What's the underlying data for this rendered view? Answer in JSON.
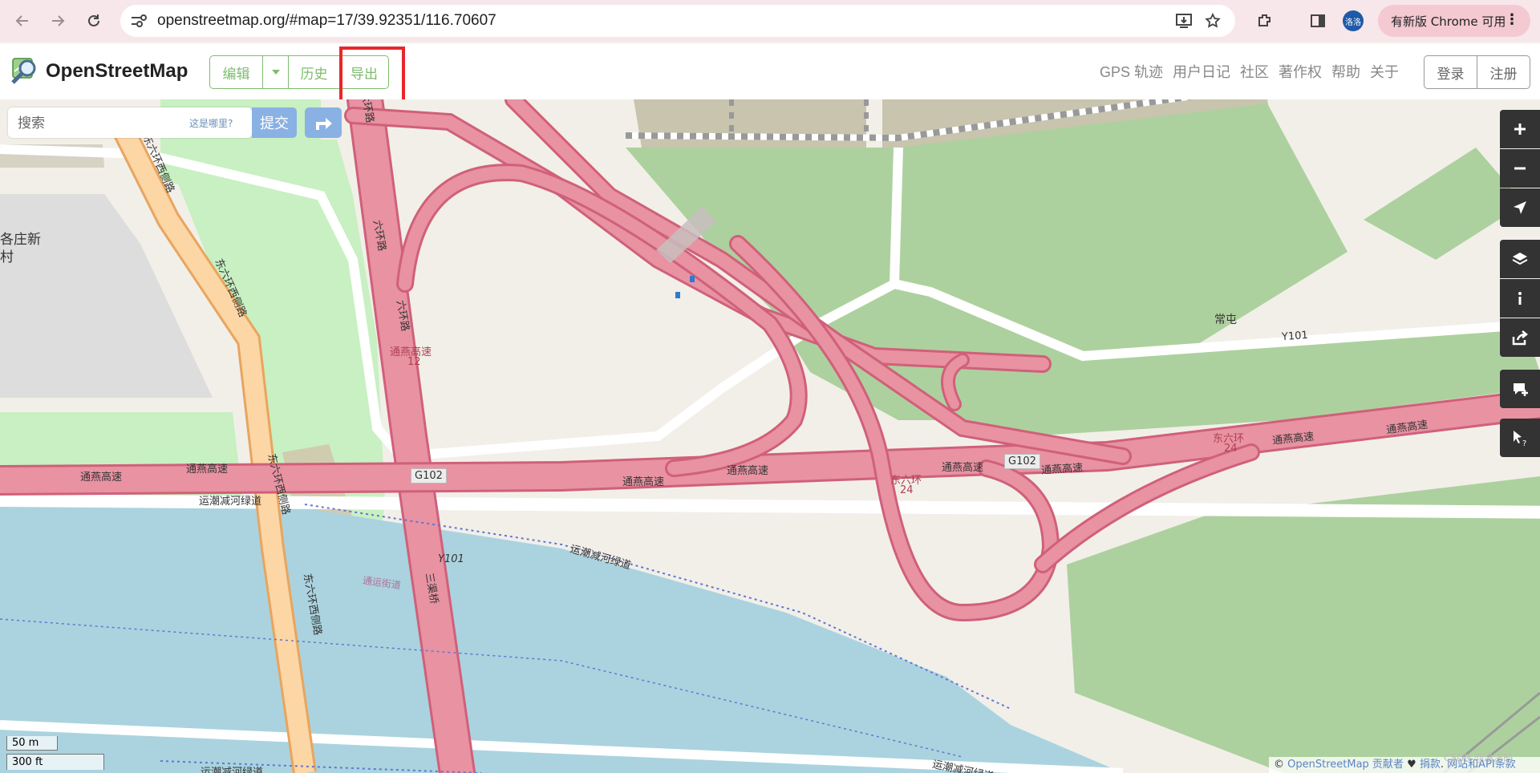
{
  "browser": {
    "url": "openstreetmap.org/#map=17/39.92351/116.70607",
    "profile_initials": "洛洛",
    "update_label": "有新版 Chrome 可用",
    "menu_glyph": "⋮"
  },
  "header": {
    "site_title": "OpenStreetMap",
    "edit_label": "编辑",
    "history_label": "历史",
    "export_label": "导出",
    "nav_links": [
      "GPS 轨迹",
      "用户日记",
      "社区",
      "著作权",
      "帮助",
      "关于"
    ],
    "login_label": "登录",
    "signup_label": "注册"
  },
  "search": {
    "placeholder": "搜索",
    "where_is_this": "这是哪里?",
    "submit_label": "提交"
  },
  "map": {
    "place_labels": [
      "常屯",
      "各庄新",
      "村"
    ],
    "road_labels": [
      "东六环西侧路",
      "东六环西侧路",
      "东六环西侧路",
      "东六环西侧路",
      "六环路",
      "六环路",
      "六环路",
      "通燕高速",
      "12",
      "通燕高速",
      "通燕高速",
      "通燕高速",
      "通燕高速",
      "通燕高速",
      "通燕高速",
      "通燕高速",
      "通燕高速",
      "东六环",
      "24",
      "东六环",
      "24",
      "Y101",
      "Y101",
      "运潮减河绿道",
      "运潮减河绿道",
      "运潮减河绿道",
      "运潮减河绿道",
      "通运街道",
      "三渠桥"
    ],
    "shields": [
      "G102",
      "G102"
    ]
  },
  "scale": {
    "metric": "50 m",
    "imperial": "300 ft"
  },
  "attribution": {
    "prefix": "© ",
    "osm_link": "OpenStreetMap 贡献者",
    "heart": " ♥ ",
    "donate": "捐款",
    "separator": ". ",
    "terms": "网站和API条款"
  },
  "watermark": "CSDN @洛洛的"
}
